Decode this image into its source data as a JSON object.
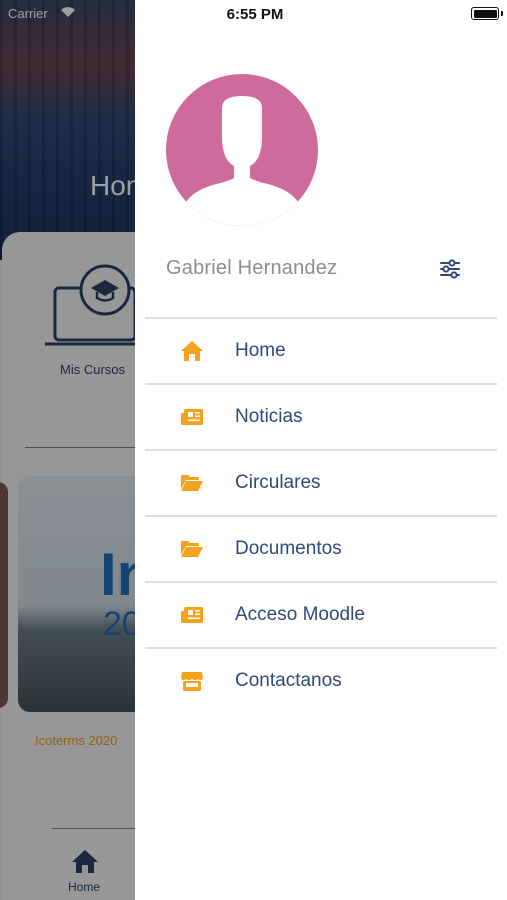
{
  "status_bar": {
    "carrier": "Carrier",
    "time": "6:55 PM"
  },
  "background_app": {
    "hero_title": "Hon",
    "course_label": "Mis Cursos",
    "thumbnail_text_1": "In",
    "thumbnail_text_2": "20",
    "thumbnail_caption": "Icoterms 2020",
    "tab_home_label": "Home"
  },
  "drawer": {
    "user_name": "Gabriel Hernandez",
    "settings_icon": "sliders-icon",
    "menu_items": [
      {
        "label": "Home",
        "icon": "home-icon"
      },
      {
        "label": "Noticias",
        "icon": "newspaper-icon"
      },
      {
        "label": "Circulares",
        "icon": "folder-open-icon"
      },
      {
        "label": "Documentos",
        "icon": "folder-open-icon"
      },
      {
        "label": "Acceso Moodle",
        "icon": "newspaper-icon"
      },
      {
        "label": "Contactanos",
        "icon": "store-icon"
      }
    ]
  },
  "colors": {
    "accent": "#f7a21c",
    "menu_text": "#2f4a7a",
    "avatar_bg": "#cf6b9c",
    "divider": "#dedede",
    "user_name": "#8e8e8e"
  }
}
